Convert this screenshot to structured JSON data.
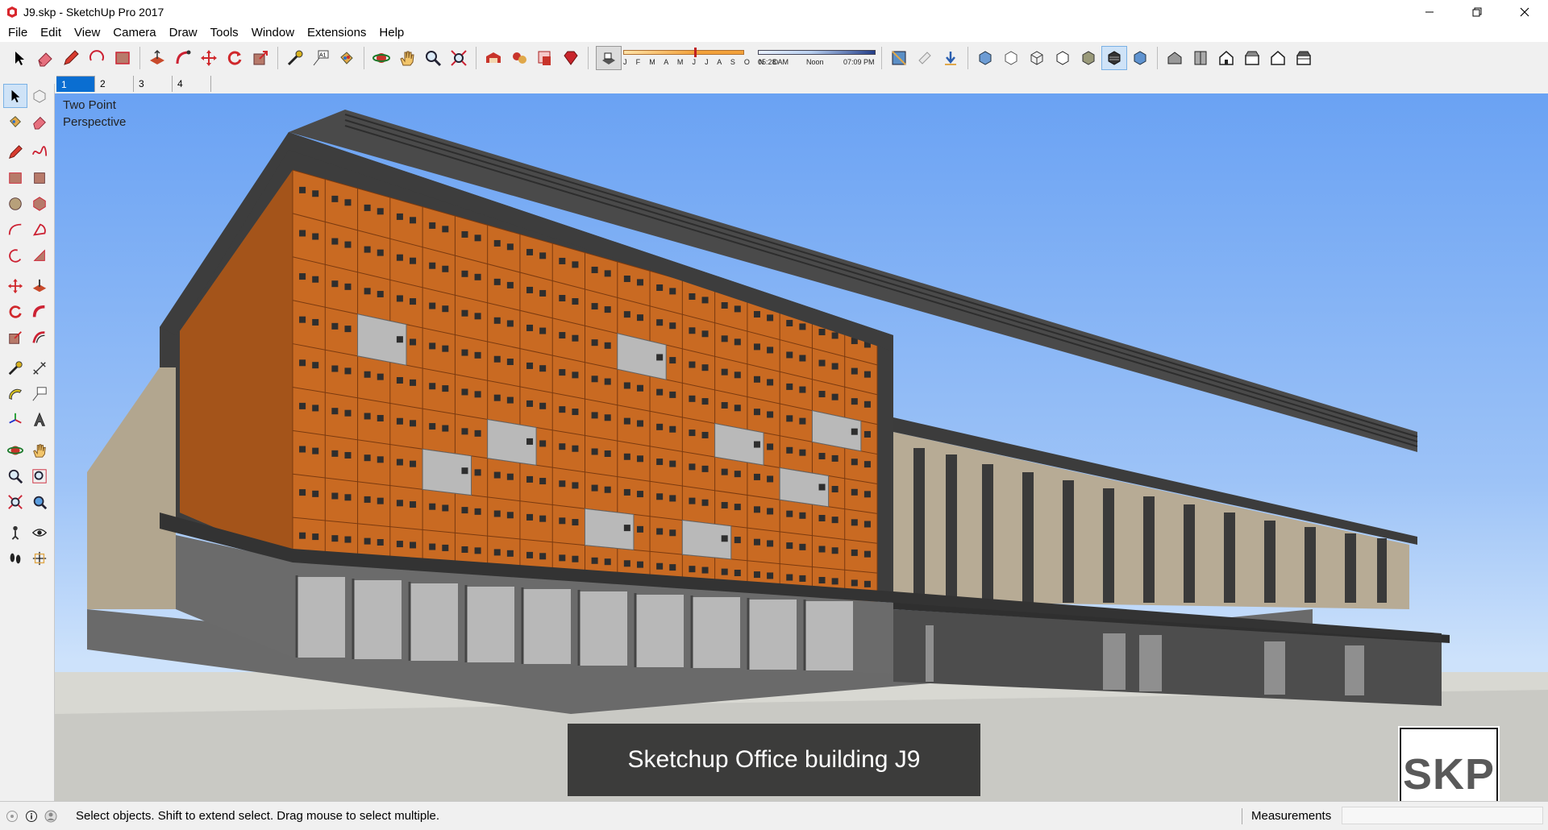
{
  "window": {
    "title": "J9.skp - SketchUp Pro 2017",
    "minimize_icon": "minimize-icon",
    "maximize_icon": "restore-icon",
    "close_icon": "close-icon"
  },
  "menu": [
    "File",
    "Edit",
    "View",
    "Camera",
    "Draw",
    "Tools",
    "Window",
    "Extensions",
    "Help"
  ],
  "toolbar": {
    "tools": [
      "select",
      "eraser",
      "pencil",
      "arc",
      "rectangle",
      "push-pull",
      "follow-me",
      "move",
      "rotate",
      "scale",
      "tape-measure",
      "text",
      "paint-bucket",
      "orbit",
      "pan",
      "zoom",
      "zoom-extents",
      "warehouse",
      "extension-warehouse",
      "layout",
      "ruby"
    ],
    "shadows": {
      "months": "J F M A M J J A S O N D",
      "time_start": "05:28 AM",
      "time_mid": "Noon",
      "time_end": "07:09 PM"
    }
  },
  "scenes": [
    "1",
    "2",
    "3",
    "4"
  ],
  "active_scene": "1",
  "viewport": {
    "camera_label_line1": "Two Point",
    "camera_label_line2": "Perspective",
    "caption": "Sketchup Office building J9",
    "logo": "SKP",
    "colors": {
      "sky_top": "#6aa2f3",
      "facade_orange": "#c96a22",
      "roof_gray": "#4a4a4a",
      "stone": "#b7ab95"
    }
  },
  "status": {
    "hint": "Select objects. Shift to extend select. Drag mouse to select multiple.",
    "measurements_label": "Measurements",
    "measurements_value": ""
  }
}
